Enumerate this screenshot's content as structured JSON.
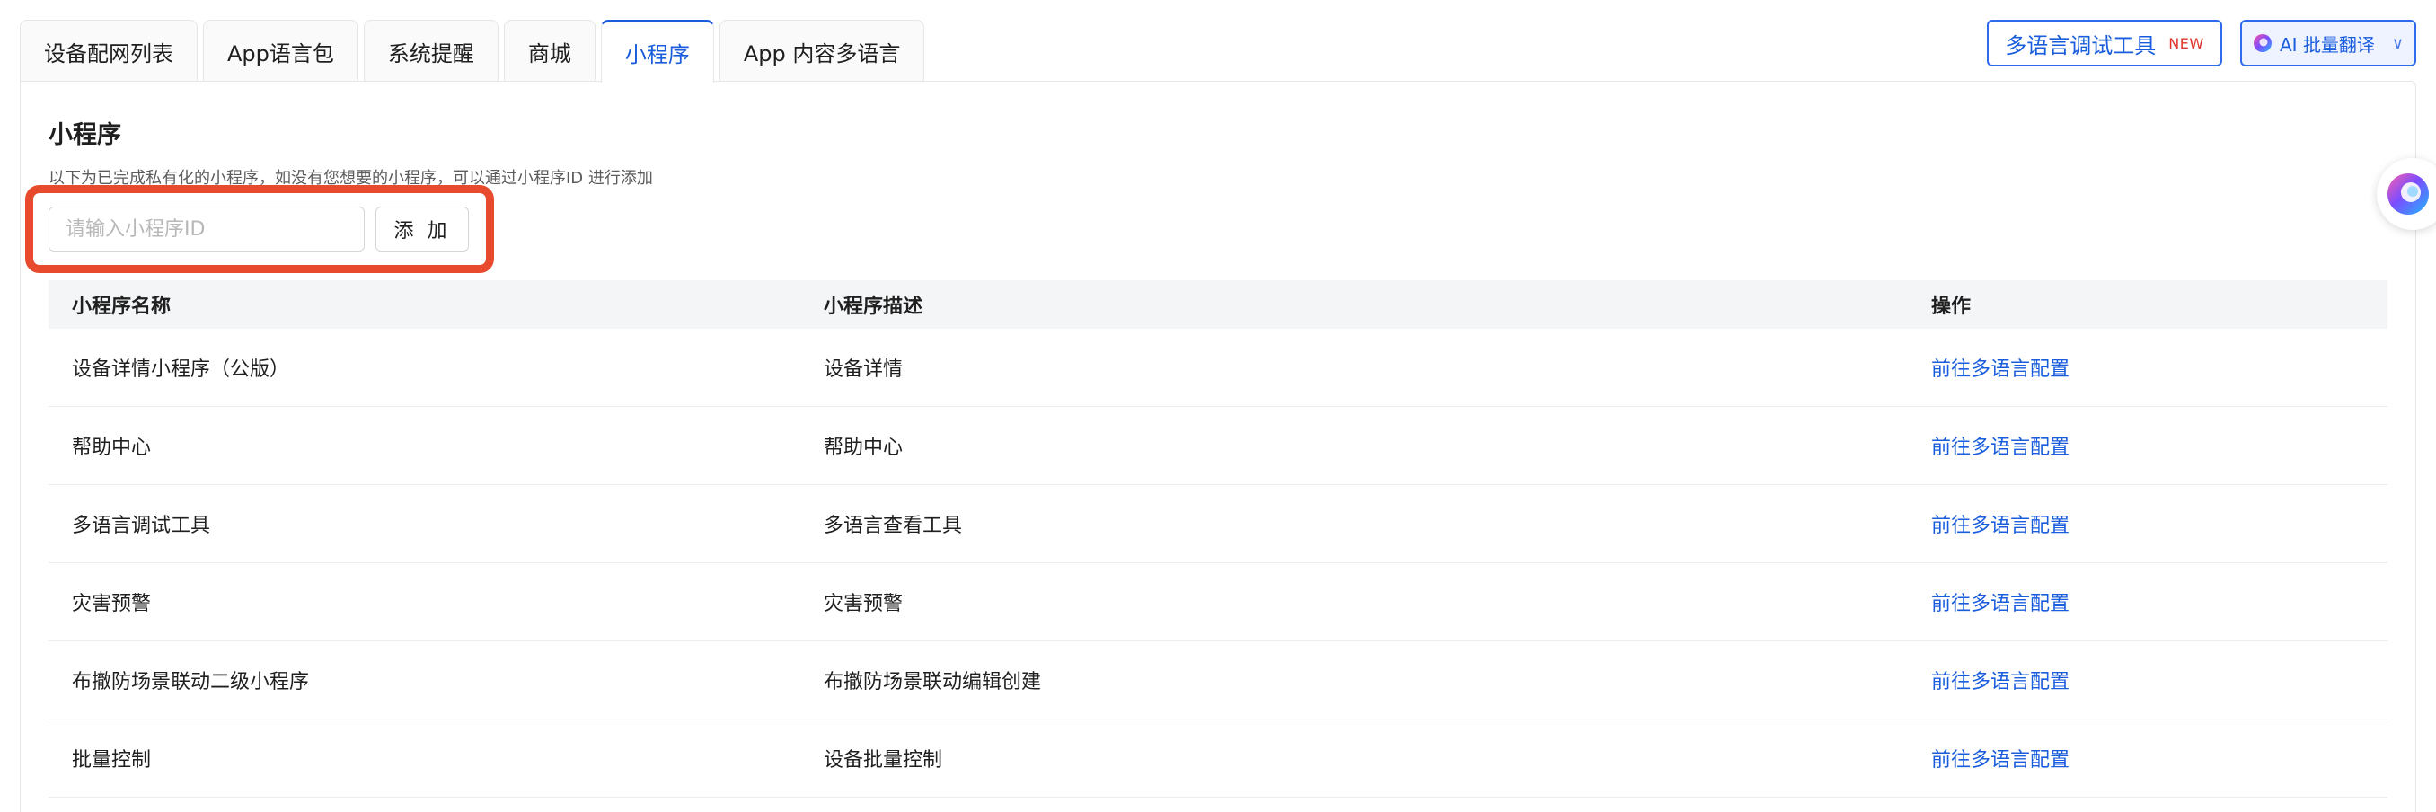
{
  "tabs": [
    {
      "label": "设备配网列表"
    },
    {
      "label": "App语言包"
    },
    {
      "label": "系统提醒"
    },
    {
      "label": "商城"
    },
    {
      "label": "小程序"
    },
    {
      "label": "App 内容多语言"
    }
  ],
  "active_tab": 4,
  "toolbar": {
    "debug_tool_label": "多语言调试工具",
    "debug_tool_badge": "NEW",
    "ai_translate_label": "AI 批量翻译"
  },
  "section": {
    "title": "小程序",
    "description": "以下为已完成私有化的小程序，如没有您想要的小程序，可以通过小程序ID 进行添加",
    "input_placeholder": "请输入小程序ID",
    "add_button_label": "添 加"
  },
  "table": {
    "columns": [
      "小程序名称",
      "小程序描述",
      "操作"
    ],
    "rows": [
      {
        "name": "设备详情小程序（公版）",
        "desc": "设备详情",
        "action": "前往多语言配置"
      },
      {
        "name": "帮助中心",
        "desc": "帮助中心",
        "action": "前往多语言配置"
      },
      {
        "name": "多语言调试工具",
        "desc": "多语言查看工具",
        "action": "前往多语言配置"
      },
      {
        "name": "灾害预警",
        "desc": "灾害预警",
        "action": "前往多语言配置"
      },
      {
        "name": "布撤防场景联动二级小程序",
        "desc": "布撤防场景联动编辑创建",
        "action": "前往多语言配置"
      },
      {
        "name": "批量控制",
        "desc": "设备批量控制",
        "action": "前往多语言配置"
      }
    ]
  },
  "colors": {
    "accent": "#1a5ddc",
    "badge_new": "#e0332b",
    "highlight": "#e74a2c"
  },
  "icons": {
    "ai": "ai-sphere-icon",
    "dropdown": "chevron-down-icon",
    "assistant": "assistant-sphere-icon"
  }
}
